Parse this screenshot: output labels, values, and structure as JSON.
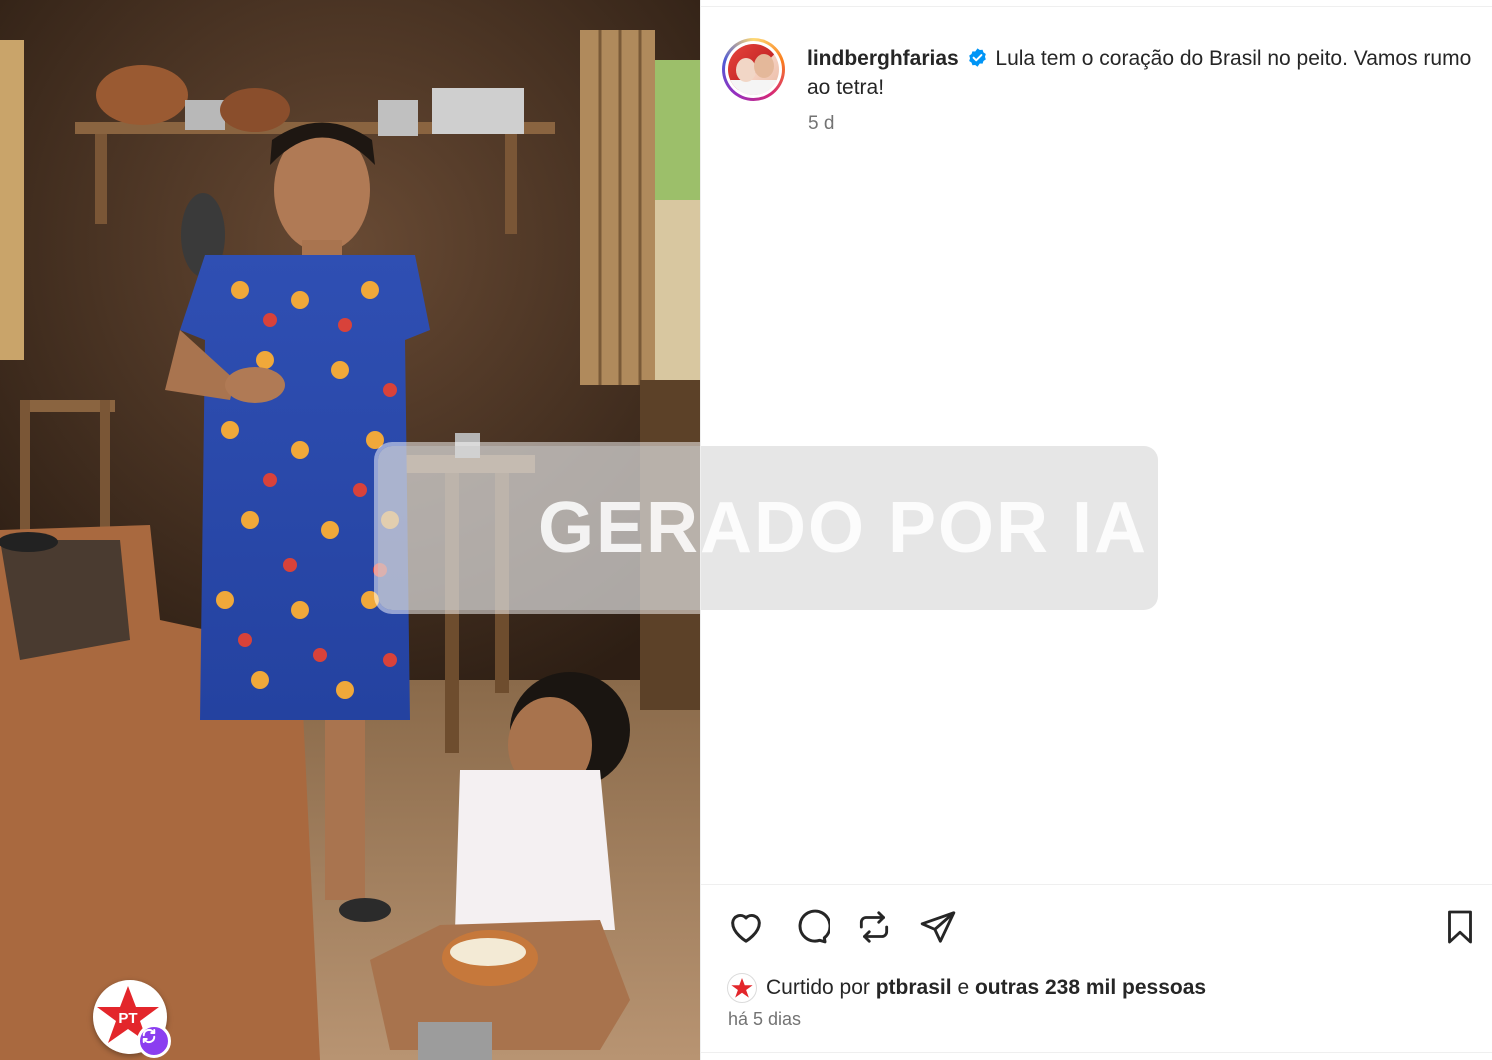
{
  "media": {
    "watermark_text": "GERADO POR IA",
    "badge_text": "PT",
    "badge_icon": "pt-star-logo",
    "repost_icon": "repost-icon"
  },
  "post": {
    "username": "lindberghfarias",
    "verified": true,
    "caption": "Lula tem o coração do Brasil no peito. Vamos rumo ao tetra!",
    "relative_time": "5 d"
  },
  "actions": {
    "like_icon": "heart-icon",
    "comment_icon": "comment-icon",
    "repost_icon": "repost-icon",
    "share_icon": "share-icon",
    "save_icon": "bookmark-icon"
  },
  "likes": {
    "prefix": "Curtido por",
    "liker": "ptbrasil",
    "conjunction": "e",
    "others": "outras 238 mil pessoas"
  },
  "date_text": "há 5 dias",
  "colors": {
    "verified": "#0095f6",
    "pt_red": "#e3262b",
    "repost_purple": "#8b3ef0"
  }
}
